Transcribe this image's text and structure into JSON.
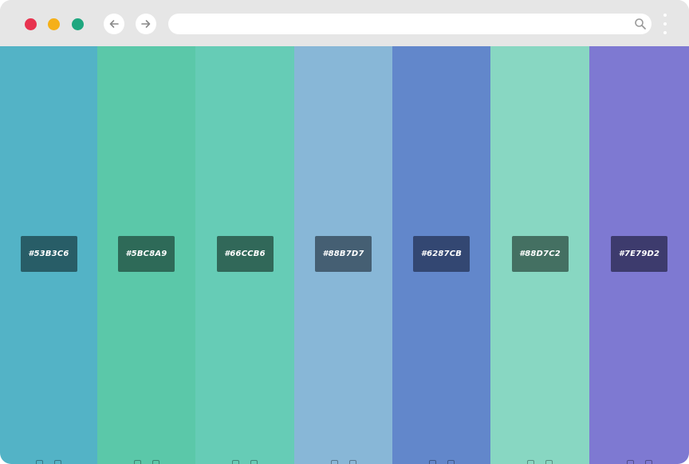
{
  "browser": {
    "traffic_lights": {
      "close": "#e8334f",
      "minimize": "#f5b018",
      "maximize": "#1ea77f"
    },
    "icons": {
      "back": "arrow-left-icon",
      "forward": "arrow-right-icon",
      "search": "search-icon",
      "menu": "more-vertical-icon"
    },
    "address_value": ""
  },
  "palette": {
    "colors": [
      {
        "hex": "#53B3C6",
        "swatch": "#53b3c6",
        "label_bg": "#285d67"
      },
      {
        "hex": "#5BC8A9",
        "swatch": "#5bc8a9",
        "label_bg": "#2e6a58"
      },
      {
        "hex": "#66CCB6",
        "swatch": "#66ccb6",
        "label_bg": "#316859"
      },
      {
        "hex": "#88B7D7",
        "swatch": "#88b7d7",
        "label_bg": "#455f73"
      },
      {
        "hex": "#6287CB",
        "swatch": "#6287cb",
        "label_bg": "#334772"
      },
      {
        "hex": "#88D7C2",
        "swatch": "#88d7c2",
        "label_bg": "#447062"
      },
      {
        "hex": "#7E79D2",
        "swatch": "#7e79d2",
        "label_bg": "#3d3b6d"
      }
    ]
  }
}
